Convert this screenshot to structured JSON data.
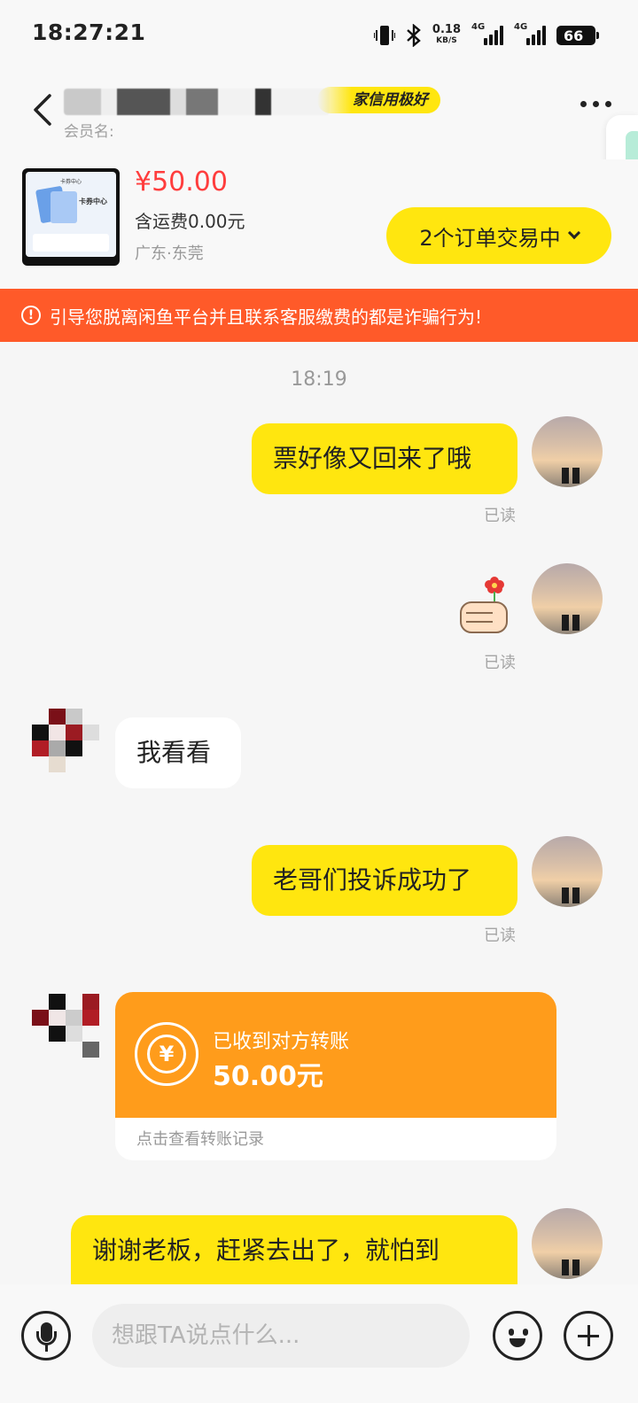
{
  "status_bar": {
    "time": "18:27:21",
    "net_speed": "0.18",
    "net_unit": "KB/S",
    "sim1": "4G",
    "sim2": "4G",
    "battery": "66"
  },
  "header": {
    "credit_badge": "家信用极好",
    "member_label": "会员名:"
  },
  "product": {
    "thumb_title": "卡券中心",
    "thumb_heading": "卡券中心",
    "price": "¥50.00",
    "shipping": "含运费0.00元",
    "location": "广东·东莞",
    "order_button": "2个订单交易中"
  },
  "warning": {
    "icon": "!",
    "text": "引导您脱离闲鱼平台并且联系客服缴费的都是诈骗行为!"
  },
  "chat": {
    "timestamp": "18:19",
    "messages": [
      {
        "side": "me",
        "type": "text",
        "text": "票好像又回来了哦",
        "status": "已读"
      },
      {
        "side": "me",
        "type": "sticker",
        "icon": "thumbs-up-flower-icon",
        "status": "已读"
      },
      {
        "side": "other",
        "type": "text",
        "text": "我看看"
      },
      {
        "side": "me",
        "type": "text",
        "text": "老哥们投诉成功了",
        "status": "已读"
      },
      {
        "side": "other",
        "type": "transfer",
        "title": "已收到对方转账",
        "amount": "50.00元",
        "link": "点击查看转账记录",
        "icon": "yuan-coin-icon"
      },
      {
        "side": "me",
        "type": "text",
        "text": "谢谢老板，赶紧去出了，就怕到"
      }
    ]
  },
  "input_bar": {
    "placeholder": "想跟TA说点什么..."
  },
  "colors": {
    "accent_yellow": "#ffe60f",
    "warning_orange": "#ff5a29",
    "transfer_orange": "#ff9c1b",
    "price_red": "#ff3d3d"
  }
}
